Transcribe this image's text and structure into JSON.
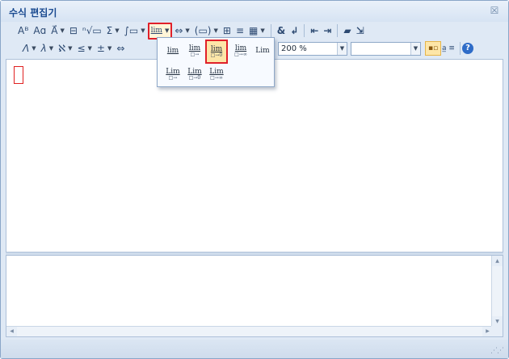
{
  "window": {
    "title": "수식 편집기",
    "close_glyph": "☒"
  },
  "toolbar1": [
    {
      "name": "font-style-button",
      "glyph": "Aᴮ",
      "arrow": false
    },
    {
      "name": "text-button",
      "glyph": "Aɑ",
      "arrow": false
    },
    {
      "name": "vector-button",
      "glyph": "A⃗",
      "arrow": true
    },
    {
      "name": "fraction-button",
      "glyph": "⊟",
      "arrow": false
    },
    {
      "name": "root-button",
      "glyph": "ⁿ√▭",
      "arrow": false
    },
    {
      "name": "sum-button",
      "glyph": "Σ",
      "arrow": true
    },
    {
      "name": "integral-button",
      "glyph": "∫▭",
      "arrow": true
    },
    {
      "name": "limit-button",
      "glyph": "lim",
      "arrow": true,
      "active": true
    },
    {
      "name": "decoration-button",
      "glyph": "⇔",
      "arrow": true
    },
    {
      "name": "bracket-button",
      "glyph": "(▭)",
      "arrow": true
    },
    {
      "name": "matrix-button",
      "glyph": "⊞",
      "arrow": false
    },
    {
      "name": "align-button",
      "glyph": "≡",
      "arrow": false
    },
    {
      "name": "table-button",
      "glyph": "▦",
      "arrow": true
    },
    {
      "name": "ampersand-button",
      "glyph": "&",
      "arrow": false
    },
    {
      "name": "newline-button",
      "glyph": "↲",
      "arrow": false
    },
    {
      "name": "move-left-button",
      "glyph": "⇤",
      "arrow": false
    },
    {
      "name": "move-right-button",
      "glyph": "⇥",
      "arrow": false
    },
    {
      "name": "open-button",
      "glyph": "📂",
      "arrow": false
    },
    {
      "name": "save-button",
      "glyph": "⇲",
      "arrow": false
    }
  ],
  "toolbar2": [
    {
      "name": "greek-upper-button",
      "glyph": "Λ",
      "arrow": true
    },
    {
      "name": "greek-lower-button",
      "glyph": "λ",
      "arrow": true
    },
    {
      "name": "hebrew-button",
      "glyph": "ℵ",
      "arrow": true
    },
    {
      "name": "relation-button",
      "glyph": "≤",
      "arrow": true
    },
    {
      "name": "operator-button",
      "glyph": "±",
      "arrow": true
    },
    {
      "name": "arrow-button",
      "glyph": "⇔",
      "arrow": false
    }
  ],
  "zoom": {
    "value": "200 %"
  },
  "font_select": {
    "value": ""
  },
  "limit_dropdown": {
    "items": [
      {
        "main": "lim",
        "sub": ""
      },
      {
        "main": "lim",
        "sub": "□→"
      },
      {
        "main": "lim",
        "sub": "□→0",
        "selected": true
      },
      {
        "main": "lim",
        "sub": "□→∞"
      },
      {
        "main": "Lim",
        "sub": ""
      },
      {
        "main": "Lim",
        "sub": "□→"
      },
      {
        "main": "Lim",
        "sub": "□→0"
      },
      {
        "main": "Lim",
        "sub": "□→∞"
      }
    ]
  },
  "editor": {
    "content": ""
  },
  "source": {
    "content": ""
  },
  "colors": {
    "accent": "#1a4a90",
    "highlight_border": "#e0202a",
    "selected_fill": "#fde6a8"
  }
}
